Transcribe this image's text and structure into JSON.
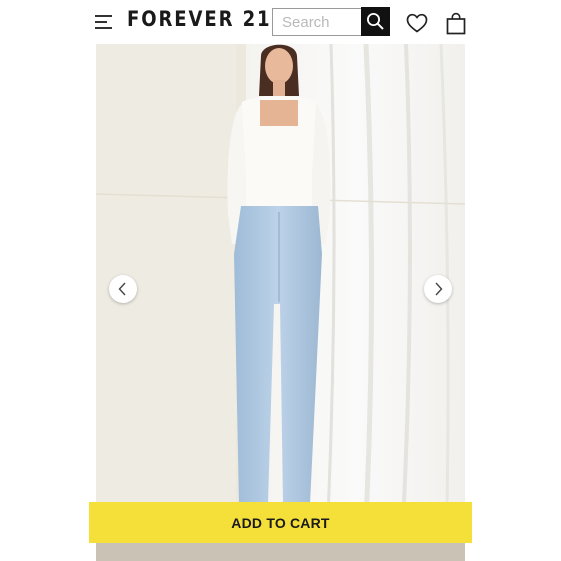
{
  "header": {
    "brand": "FOREVER 21",
    "search": {
      "placeholder": "Search",
      "value": ""
    },
    "icons": [
      "menu-icon",
      "search-icon",
      "heart-icon",
      "shopping-bag-icon"
    ]
  },
  "gallery": {
    "image_description": "Model wearing white square-neck long-sleeve top and light-wash high-rise flare jeans",
    "prev_icon": "chevron-left-icon",
    "next_icon": "chevron-right-icon"
  },
  "actions": {
    "add_to_cart_label": "ADD TO CART"
  },
  "colors": {
    "header_bg": "#ffffff",
    "search_button": "#111111",
    "cta_yellow": "#f5e03a",
    "text_dark": "#1a1a1a"
  }
}
